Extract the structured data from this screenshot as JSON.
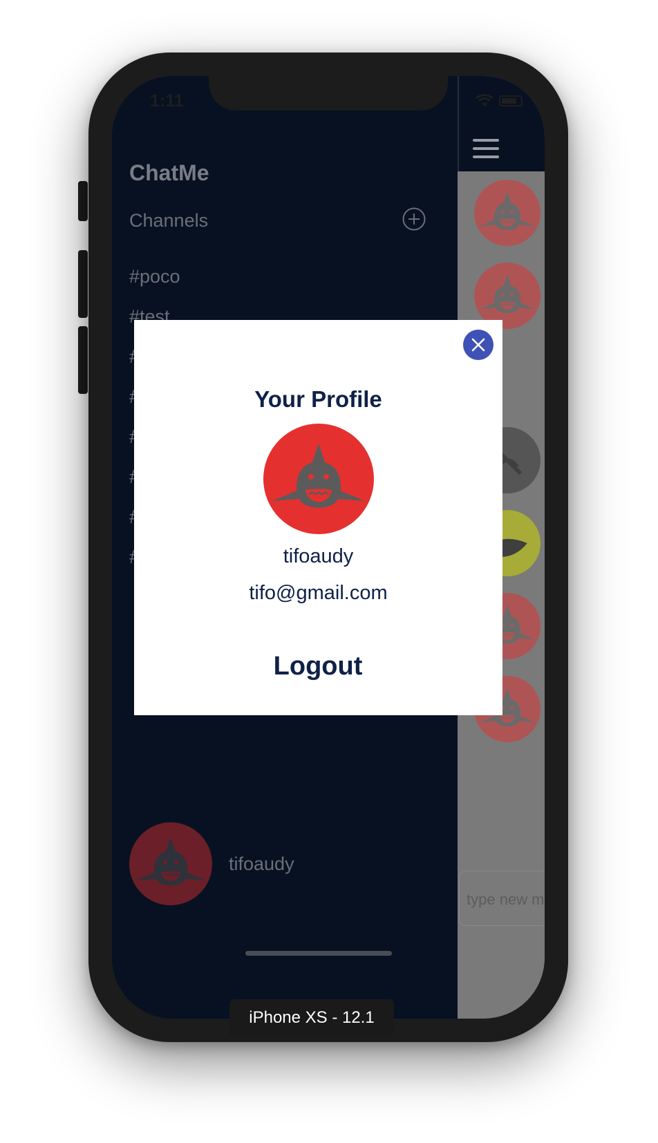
{
  "status_bar": {
    "time": "1:11"
  },
  "drawer": {
    "app_name": "ChatMe",
    "channels_label": "Channels",
    "add_channel_icon": "plus-circle-icon",
    "channels": [
      "#poco",
      "#test",
      "#",
      "#",
      "#",
      "#",
      "#",
      "#"
    ],
    "user": {
      "name": "tifoaudy"
    }
  },
  "main": {
    "menu_icon": "hamburger-icon",
    "message_input": {
      "placeholder": "type new message"
    }
  },
  "profile_modal": {
    "close_icon": "close-icon",
    "title": "Your Profile",
    "username": "tifoaudy",
    "email": "tifo@gmail.com",
    "logout_label": "Logout"
  },
  "simulator": {
    "device_label": "iPhone XS - 12.1"
  },
  "colors": {
    "drawer_bg": "#071122",
    "modal_text": "#0f2147",
    "close_button": "#3f51b5",
    "avatar_red": "#e53030",
    "shark_grey": "#5b5b5b"
  }
}
